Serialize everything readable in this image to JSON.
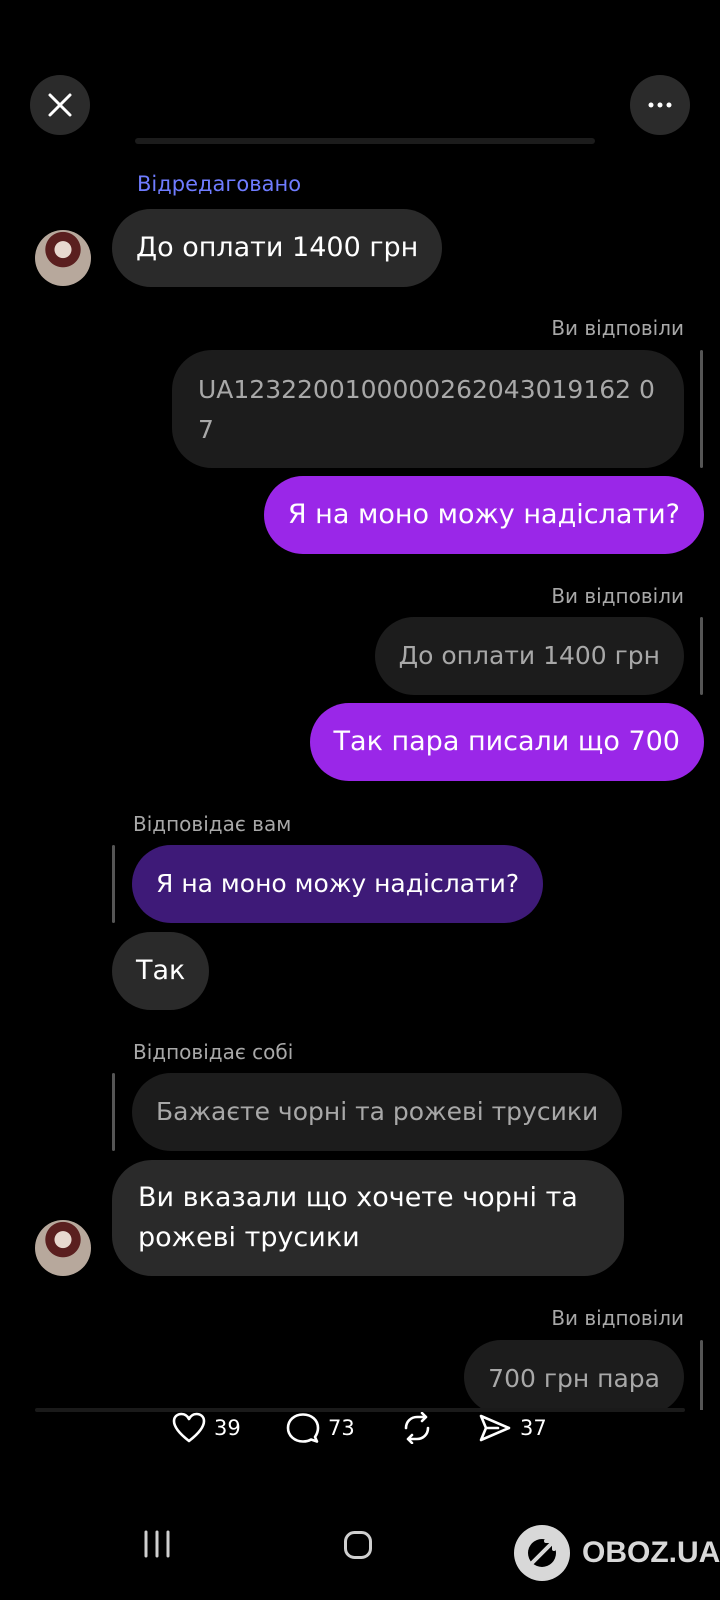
{
  "header": {
    "close_icon": "close-icon",
    "more_icon": "more-icon"
  },
  "messages": {
    "edited_label": "Відредаговано",
    "m1": "До оплати 1400 грн",
    "reply1_label": "Ви відповіли",
    "quote1_line1": "UA1232200100000262043019162 0",
    "quote1_line2": "7",
    "out1": "Я на моно можу надіслати?",
    "reply2_label": "Ви відповіли",
    "quote2": "До оплати 1400 грн",
    "out2": "Так пара писали що 700",
    "reply3_label": "Відповідає вам",
    "quote3": "Я на моно можу надіслати?",
    "in2": "Так",
    "reply4_label": "Відповідає собі",
    "quote4": "Бажаєте чорні та рожеві трусики",
    "in3_line1": "Ви вказали що хочете чорні та",
    "in3_line2": "рожеві трусики",
    "reply5_label": "Ви відповіли",
    "quote5": "700 грн пара"
  },
  "actions": {
    "likes": "39",
    "comments": "73",
    "shares": "37"
  },
  "watermark": {
    "text": "OBOZ.UA"
  }
}
